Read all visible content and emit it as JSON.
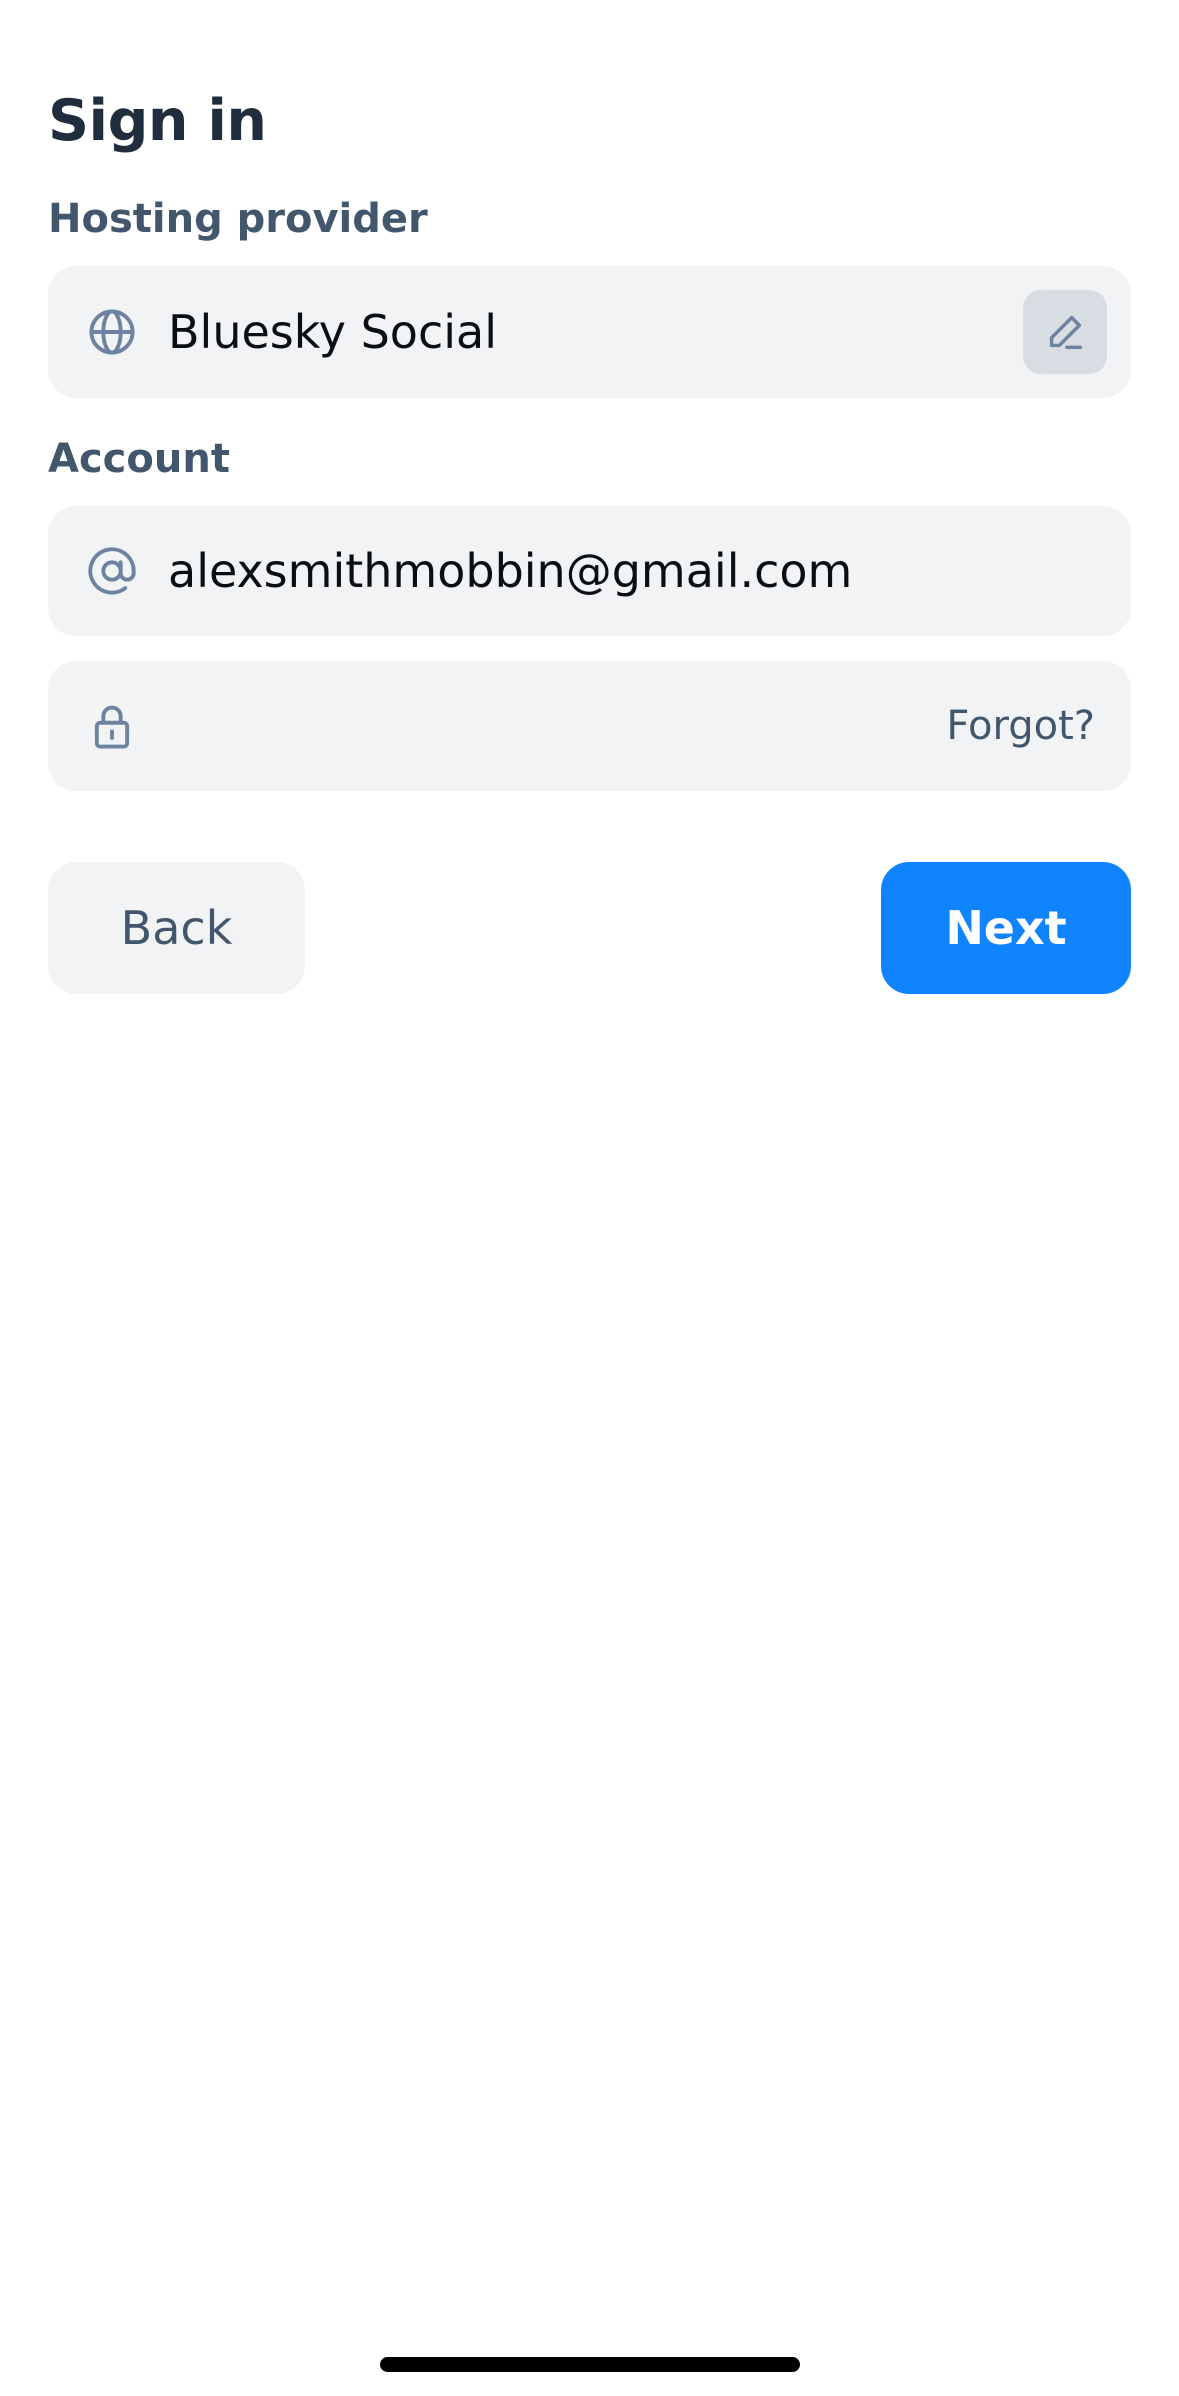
{
  "header": {
    "title": "Sign in"
  },
  "hosting": {
    "label": "Hosting provider",
    "value": "Bluesky Social",
    "icon": "globe-icon",
    "edit_icon": "pencil-icon"
  },
  "account": {
    "label": "Account",
    "email_value": "alexsmithmobbin@gmail.com",
    "email_icon": "at-sign-icon",
    "password_value": "",
    "password_icon": "lock-icon",
    "forgot_label": "Forgot?"
  },
  "actions": {
    "back_label": "Back",
    "next_label": "Next"
  },
  "colors": {
    "primary": "#1083fe",
    "field_background": "#f1f3f5",
    "label_text": "#42576c",
    "title_text": "#1f2d3d",
    "icon": "#6d83a0"
  }
}
